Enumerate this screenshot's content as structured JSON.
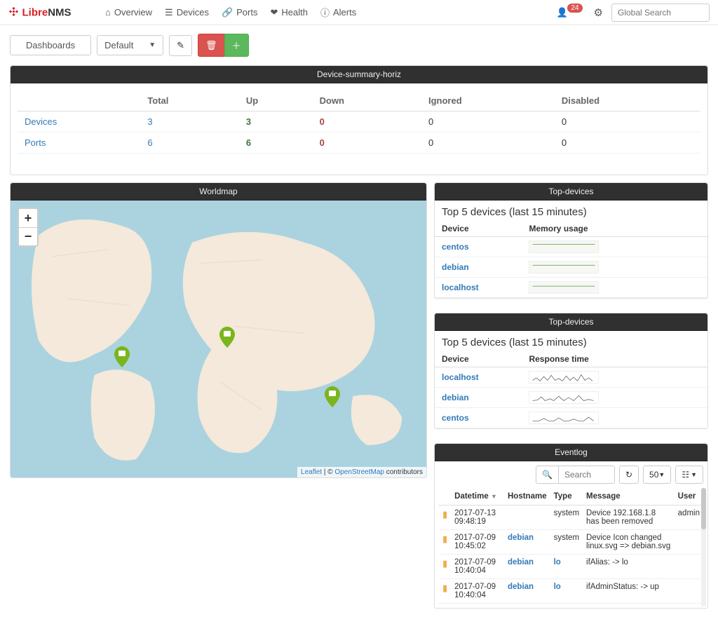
{
  "brand": {
    "name": "LibreNMS",
    "accent": "#d72025"
  },
  "nav": [
    {
      "icon": "home-icon",
      "label": "Overview"
    },
    {
      "icon": "devices-icon",
      "label": "Devices"
    },
    {
      "icon": "ports-icon",
      "label": "Ports"
    },
    {
      "icon": "health-icon",
      "label": "Health"
    },
    {
      "icon": "alerts-icon",
      "label": "Alerts"
    }
  ],
  "user": {
    "badge": "24"
  },
  "search": {
    "placeholder": "Global Search"
  },
  "dashboard": {
    "label": "Dashboards",
    "selected": "Default"
  },
  "summary": {
    "title": "Device-summary-horiz",
    "headers": [
      "",
      "Total",
      "Up",
      "Down",
      "Ignored",
      "Disabled"
    ],
    "rows": [
      {
        "label": "Devices",
        "total": "3",
        "up": "3",
        "down": "0",
        "ignored": "0",
        "disabled": "0"
      },
      {
        "label": "Ports",
        "total": "6",
        "up": "6",
        "down": "0",
        "ignored": "0",
        "disabled": "0"
      }
    ]
  },
  "worldmap": {
    "title": "Worldmap",
    "zoom_in": "+",
    "zoom_out": "−",
    "attribution": {
      "leaflet": "Leaflet",
      "sep": " | © ",
      "osm": "OpenStreetMap",
      "tail": " contributors"
    }
  },
  "topdev1": {
    "title": "Top-devices",
    "subtitle": "Top 5 devices (last 15 minutes)",
    "col_device": "Device",
    "col_metric": "Memory usage",
    "rows": [
      {
        "device": "centos"
      },
      {
        "device": "debian"
      },
      {
        "device": "localhost"
      }
    ]
  },
  "topdev2": {
    "title": "Top-devices",
    "subtitle": "Top 5 devices (last 15 minutes)",
    "col_device": "Device",
    "col_metric": "Response time",
    "rows": [
      {
        "device": "localhost"
      },
      {
        "device": "debian"
      },
      {
        "device": "centos"
      }
    ]
  },
  "eventlog": {
    "title": "Eventlog",
    "search_placeholder": "Search",
    "page_size": "50 ",
    "headers": {
      "dt": "Datetime",
      "host": "Hostname",
      "type": "Type",
      "msg": "Message",
      "user": "User"
    },
    "rows": [
      {
        "dt": "2017-07-13 09:48:19",
        "host": "",
        "type": "system",
        "msg": "Device 192.168.1.8 has been removed",
        "user": "admin"
      },
      {
        "dt": "2017-07-09 10:45:02",
        "host": "debian",
        "type": "system",
        "msg": "Device Icon changed linux.svg => debian.svg",
        "user": ""
      },
      {
        "dt": "2017-07-09 10:40:04",
        "host": "debian",
        "type": "lo",
        "msg": "ifAlias: -> lo",
        "user": ""
      },
      {
        "dt": "2017-07-09 10:40:04",
        "host": "debian",
        "type": "lo",
        "msg": "ifAdminStatus: -> up",
        "user": ""
      }
    ]
  }
}
